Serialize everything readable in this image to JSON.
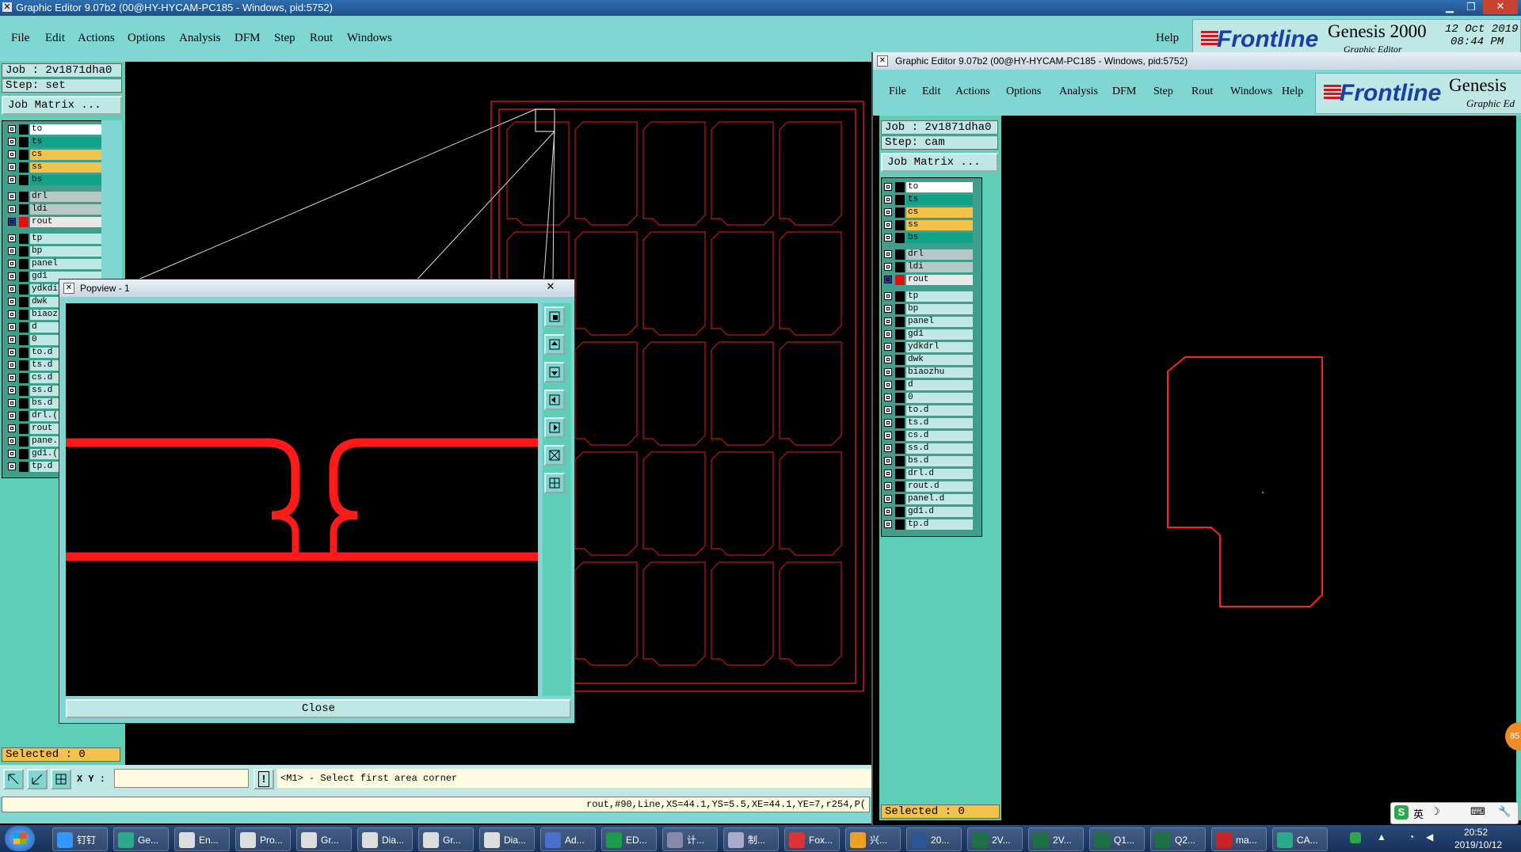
{
  "main_window": {
    "title": "Graphic Editor 9.07b2 (00@HY-HYCAM-PC185 - Windows, pid:5752)",
    "menu": [
      "File",
      "Edit",
      "Actions",
      "Options",
      "Analysis",
      "DFM",
      "Step",
      "Rout",
      "Windows"
    ],
    "help": "Help",
    "brand": "Frontline",
    "product": "Genesis 2000",
    "product_sub": "Graphic Editor",
    "date": "12 Oct 2019",
    "time": "08:44 PM",
    "job": "Job : 2v1871dha0",
    "step": "Step: set",
    "job_matrix": "Job Matrix ...",
    "selected": "Selected : 0",
    "xy_label": "X Y :",
    "xy_value": "",
    "prompt": "<M1> - Select first area corner",
    "status": "rout,#90,Line,XS=44.1,YS=5.5,XE=44.1,YE=7,r254,P("
  },
  "layers_main": [
    {
      "name": "to",
      "color": "#ffffff"
    },
    {
      "name": "ts",
      "color": "#11a38a"
    },
    {
      "name": "cs",
      "color": "#f2c24a"
    },
    {
      "name": "ss",
      "color": "#f2c24a"
    },
    {
      "name": "bs",
      "color": "#11a38a"
    },
    {
      "name": "drl",
      "color": "#b7c9c7"
    },
    {
      "name": "ldi",
      "color": "#b7c9c7"
    },
    {
      "name": "rout",
      "color": "#e8e8e8"
    },
    {
      "name": "tp",
      "color": "#bfe7e3"
    },
    {
      "name": "bp",
      "color": "#bfe7e3"
    },
    {
      "name": "panel",
      "color": "#bfe7e3"
    },
    {
      "name": "gd1",
      "color": "#bfe7e3"
    },
    {
      "name": "ydkdi",
      "color": "#bfe7e3"
    },
    {
      "name": "dwk",
      "color": "#bfe7e3"
    },
    {
      "name": "biaoz",
      "color": "#bfe7e3"
    },
    {
      "name": "d",
      "color": "#bfe7e3"
    },
    {
      "name": "0",
      "color": "#bfe7e3"
    },
    {
      "name": "to.d",
      "color": "#bfe7e3"
    },
    {
      "name": "ts.d",
      "color": "#bfe7e3"
    },
    {
      "name": "cs.d",
      "color": "#bfe7e3"
    },
    {
      "name": "ss.d",
      "color": "#bfe7e3"
    },
    {
      "name": "bs.d",
      "color": "#bfe7e3"
    },
    {
      "name": "drl.(",
      "color": "#bfe7e3"
    },
    {
      "name": "rout",
      "color": "#bfe7e3"
    },
    {
      "name": "pane.",
      "color": "#bfe7e3"
    },
    {
      "name": "gd1.(",
      "color": "#bfe7e3"
    },
    {
      "name": "tp.d",
      "color": "#bfe7e3"
    }
  ],
  "popview": {
    "title": "Popview - 1",
    "close_x": "✕",
    "close_button": "Close"
  },
  "second_window": {
    "title": "Graphic Editor 9.07b2 (00@HY-HYCAM-PC185 - Windows, pid:5752)",
    "menu": [
      "File",
      "Edit",
      "Actions",
      "Options",
      "Analysis",
      "DFM",
      "Step",
      "Rout",
      "Windows",
      "Help"
    ],
    "brand": "Frontline",
    "product": "Genesis",
    "product_sub": "Graphic Ed",
    "job": "Job : 2v1871dha0",
    "step": "Step: cam",
    "job_matrix": "Job Matrix ...",
    "selected": "Selected : 0"
  },
  "layers_second": [
    {
      "name": "to",
      "color": "#ffffff"
    },
    {
      "name": "ts",
      "color": "#11a38a"
    },
    {
      "name": "cs",
      "color": "#f2c24a"
    },
    {
      "name": "ss",
      "color": "#f2c24a"
    },
    {
      "name": "bs",
      "color": "#11a38a"
    },
    {
      "name": "drl",
      "color": "#b7c9c7"
    },
    {
      "name": "ldi",
      "color": "#b7c9c7"
    },
    {
      "name": "rout",
      "color": "#e8e8e8"
    },
    {
      "name": "tp",
      "color": "#bfe7e3"
    },
    {
      "name": "bp",
      "color": "#bfe7e3"
    },
    {
      "name": "panel",
      "color": "#bfe7e3"
    },
    {
      "name": "gd1",
      "color": "#bfe7e3"
    },
    {
      "name": "ydkdrl",
      "color": "#bfe7e3"
    },
    {
      "name": "dwk",
      "color": "#bfe7e3"
    },
    {
      "name": "biaozhu",
      "color": "#bfe7e3"
    },
    {
      "name": "d",
      "color": "#bfe7e3"
    },
    {
      "name": "0",
      "color": "#bfe7e3"
    },
    {
      "name": "to.d",
      "color": "#bfe7e3"
    },
    {
      "name": "ts.d",
      "color": "#bfe7e3"
    },
    {
      "name": "cs.d",
      "color": "#bfe7e3"
    },
    {
      "name": "ss.d",
      "color": "#bfe7e3"
    },
    {
      "name": "bs.d",
      "color": "#bfe7e3"
    },
    {
      "name": "drl.d",
      "color": "#bfe7e3"
    },
    {
      "name": "rout.d",
      "color": "#bfe7e3"
    },
    {
      "name": "panel.d",
      "color": "#bfe7e3"
    },
    {
      "name": "gd1.d",
      "color": "#bfe7e3"
    },
    {
      "name": "tp.d",
      "color": "#bfe7e3"
    }
  ],
  "taskbar": {
    "items": [
      {
        "label": "钉钉",
        "icon": "dingtalk-icon",
        "color": "#3296fa"
      },
      {
        "label": "Ge...",
        "icon": "genesis-icon",
        "color": "#2ca98a"
      },
      {
        "label": "En...",
        "icon": "x-window-icon",
        "color": "#ddd"
      },
      {
        "label": "Pro...",
        "icon": "x-window-icon",
        "color": "#ddd"
      },
      {
        "label": "Gr...",
        "icon": "x-window-icon",
        "color": "#ddd"
      },
      {
        "label": "Dia...",
        "icon": "x-window-icon",
        "color": "#ddd"
      },
      {
        "label": "Gr...",
        "icon": "x-window-icon",
        "color": "#ddd"
      },
      {
        "label": "Dia...",
        "icon": "x-window-icon",
        "color": "#ddd"
      },
      {
        "label": "Ad...",
        "icon": "save-icon",
        "color": "#4a6fd1"
      },
      {
        "label": "ED...",
        "icon": "frontline-f-icon",
        "color": "#1a9d4b"
      },
      {
        "label": "计...",
        "icon": "calculator-icon",
        "color": "#88a"
      },
      {
        "label": "制...",
        "icon": "notepad-icon",
        "color": "#aac"
      },
      {
        "label": "Fox...",
        "icon": "foxmail-icon",
        "color": "#d33"
      },
      {
        "label": "兴...",
        "icon": "flower-icon",
        "color": "#f0a020"
      },
      {
        "label": "20...",
        "icon": "word-icon",
        "color": "#2b5797"
      },
      {
        "label": "2V...",
        "icon": "excel-icon",
        "color": "#1e7145"
      },
      {
        "label": "2V...",
        "icon": "excel-icon",
        "color": "#1e7145"
      },
      {
        "label": "Q1...",
        "icon": "excel-icon",
        "color": "#1e7145"
      },
      {
        "label": "Q2...",
        "icon": "excel-icon",
        "color": "#1e7145"
      },
      {
        "label": "ma...",
        "icon": "pdf-icon",
        "color": "#c22"
      },
      {
        "label": "CA...",
        "icon": "genesis-icon",
        "color": "#2ca98a"
      }
    ],
    "clock_time": "20:52",
    "clock_date": "2019/10/12",
    "ime": "英"
  }
}
